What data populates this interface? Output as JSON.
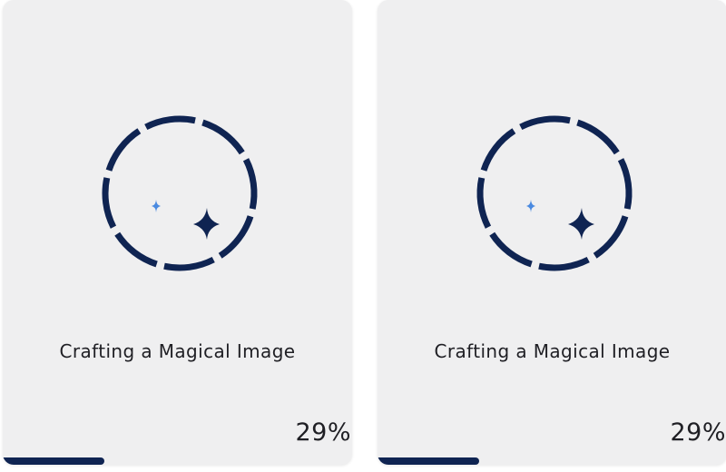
{
  "colors": {
    "card_background": "#efeff0",
    "ring": "#0f2452",
    "sparkle_large": "#0f2452",
    "sparkle_small": "#4a8ae0",
    "progress_fill": "#0f2452",
    "text": "#1f1f24"
  },
  "cards": [
    {
      "icon": "sparkle-loader-icon",
      "caption": "Crafting a Magical Image",
      "percent_label": "29%",
      "progress": 0.29
    },
    {
      "icon": "sparkle-loader-icon",
      "caption": "Crafting a Magical Image",
      "percent_label": "29%",
      "progress": 0.29
    }
  ]
}
